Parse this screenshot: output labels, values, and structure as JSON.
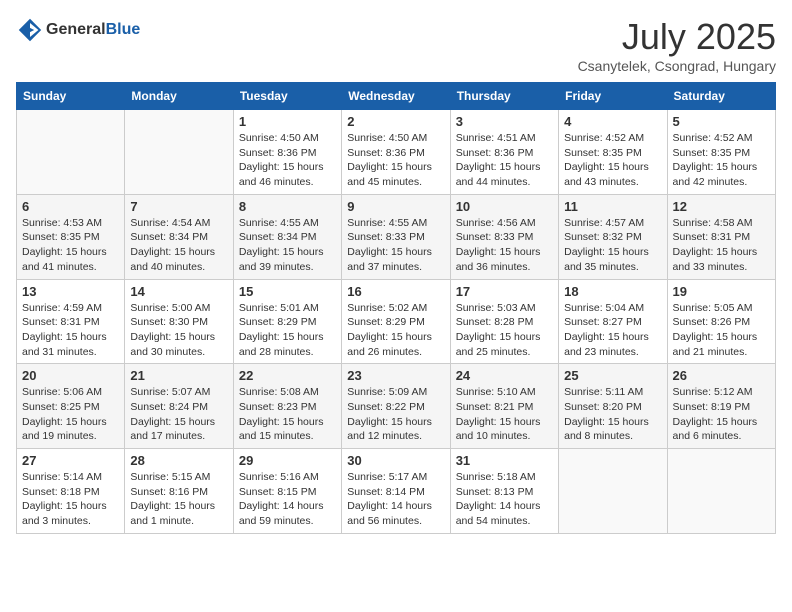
{
  "header": {
    "logo_general": "General",
    "logo_blue": "Blue",
    "month_title": "July 2025",
    "location": "Csanytelek, Csongrad, Hungary"
  },
  "weekdays": [
    "Sunday",
    "Monday",
    "Tuesday",
    "Wednesday",
    "Thursday",
    "Friday",
    "Saturday"
  ],
  "weeks": [
    [
      {
        "day": "",
        "info": ""
      },
      {
        "day": "",
        "info": ""
      },
      {
        "day": "1",
        "info": "Sunrise: 4:50 AM\nSunset: 8:36 PM\nDaylight: 15 hours and 46 minutes."
      },
      {
        "day": "2",
        "info": "Sunrise: 4:50 AM\nSunset: 8:36 PM\nDaylight: 15 hours and 45 minutes."
      },
      {
        "day": "3",
        "info": "Sunrise: 4:51 AM\nSunset: 8:36 PM\nDaylight: 15 hours and 44 minutes."
      },
      {
        "day": "4",
        "info": "Sunrise: 4:52 AM\nSunset: 8:35 PM\nDaylight: 15 hours and 43 minutes."
      },
      {
        "day": "5",
        "info": "Sunrise: 4:52 AM\nSunset: 8:35 PM\nDaylight: 15 hours and 42 minutes."
      }
    ],
    [
      {
        "day": "6",
        "info": "Sunrise: 4:53 AM\nSunset: 8:35 PM\nDaylight: 15 hours and 41 minutes."
      },
      {
        "day": "7",
        "info": "Sunrise: 4:54 AM\nSunset: 8:34 PM\nDaylight: 15 hours and 40 minutes."
      },
      {
        "day": "8",
        "info": "Sunrise: 4:55 AM\nSunset: 8:34 PM\nDaylight: 15 hours and 39 minutes."
      },
      {
        "day": "9",
        "info": "Sunrise: 4:55 AM\nSunset: 8:33 PM\nDaylight: 15 hours and 37 minutes."
      },
      {
        "day": "10",
        "info": "Sunrise: 4:56 AM\nSunset: 8:33 PM\nDaylight: 15 hours and 36 minutes."
      },
      {
        "day": "11",
        "info": "Sunrise: 4:57 AM\nSunset: 8:32 PM\nDaylight: 15 hours and 35 minutes."
      },
      {
        "day": "12",
        "info": "Sunrise: 4:58 AM\nSunset: 8:31 PM\nDaylight: 15 hours and 33 minutes."
      }
    ],
    [
      {
        "day": "13",
        "info": "Sunrise: 4:59 AM\nSunset: 8:31 PM\nDaylight: 15 hours and 31 minutes."
      },
      {
        "day": "14",
        "info": "Sunrise: 5:00 AM\nSunset: 8:30 PM\nDaylight: 15 hours and 30 minutes."
      },
      {
        "day": "15",
        "info": "Sunrise: 5:01 AM\nSunset: 8:29 PM\nDaylight: 15 hours and 28 minutes."
      },
      {
        "day": "16",
        "info": "Sunrise: 5:02 AM\nSunset: 8:29 PM\nDaylight: 15 hours and 26 minutes."
      },
      {
        "day": "17",
        "info": "Sunrise: 5:03 AM\nSunset: 8:28 PM\nDaylight: 15 hours and 25 minutes."
      },
      {
        "day": "18",
        "info": "Sunrise: 5:04 AM\nSunset: 8:27 PM\nDaylight: 15 hours and 23 minutes."
      },
      {
        "day": "19",
        "info": "Sunrise: 5:05 AM\nSunset: 8:26 PM\nDaylight: 15 hours and 21 minutes."
      }
    ],
    [
      {
        "day": "20",
        "info": "Sunrise: 5:06 AM\nSunset: 8:25 PM\nDaylight: 15 hours and 19 minutes."
      },
      {
        "day": "21",
        "info": "Sunrise: 5:07 AM\nSunset: 8:24 PM\nDaylight: 15 hours and 17 minutes."
      },
      {
        "day": "22",
        "info": "Sunrise: 5:08 AM\nSunset: 8:23 PM\nDaylight: 15 hours and 15 minutes."
      },
      {
        "day": "23",
        "info": "Sunrise: 5:09 AM\nSunset: 8:22 PM\nDaylight: 15 hours and 12 minutes."
      },
      {
        "day": "24",
        "info": "Sunrise: 5:10 AM\nSunset: 8:21 PM\nDaylight: 15 hours and 10 minutes."
      },
      {
        "day": "25",
        "info": "Sunrise: 5:11 AM\nSunset: 8:20 PM\nDaylight: 15 hours and 8 minutes."
      },
      {
        "day": "26",
        "info": "Sunrise: 5:12 AM\nSunset: 8:19 PM\nDaylight: 15 hours and 6 minutes."
      }
    ],
    [
      {
        "day": "27",
        "info": "Sunrise: 5:14 AM\nSunset: 8:18 PM\nDaylight: 15 hours and 3 minutes."
      },
      {
        "day": "28",
        "info": "Sunrise: 5:15 AM\nSunset: 8:16 PM\nDaylight: 15 hours and 1 minute."
      },
      {
        "day": "29",
        "info": "Sunrise: 5:16 AM\nSunset: 8:15 PM\nDaylight: 14 hours and 59 minutes."
      },
      {
        "day": "30",
        "info": "Sunrise: 5:17 AM\nSunset: 8:14 PM\nDaylight: 14 hours and 56 minutes."
      },
      {
        "day": "31",
        "info": "Sunrise: 5:18 AM\nSunset: 8:13 PM\nDaylight: 14 hours and 54 minutes."
      },
      {
        "day": "",
        "info": ""
      },
      {
        "day": "",
        "info": ""
      }
    ]
  ]
}
